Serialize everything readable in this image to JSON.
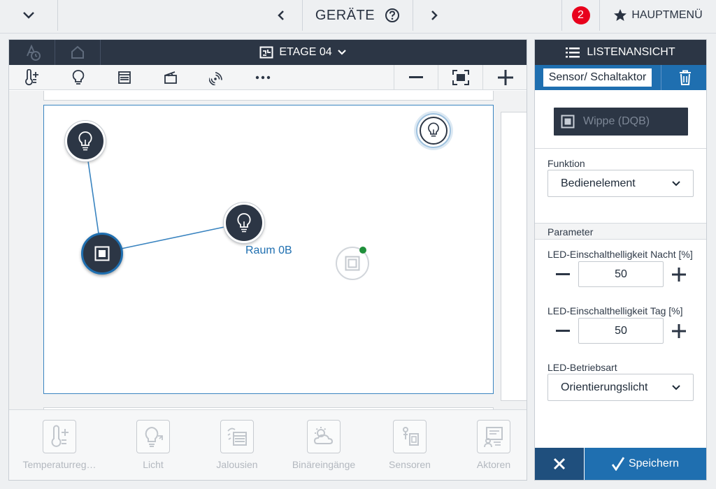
{
  "topbar": {
    "title": "GERÄTE",
    "badge_count": "2",
    "mainmenu_label": "HAUPTMENÜ"
  },
  "floor": {
    "label": "ETAGE 04"
  },
  "canvas": {
    "room_label": "Raum 0B"
  },
  "categories": [
    {
      "label": "Temperaturreg…",
      "icon": "thermometer-plus-icon"
    },
    {
      "label": "Licht",
      "icon": "bulb-icon"
    },
    {
      "label": "Jalousien",
      "icon": "blind-icon"
    },
    {
      "label": "Binäreingänge",
      "icon": "weather-sensor-icon"
    },
    {
      "label": "Sensoren",
      "icon": "sensor-icon"
    },
    {
      "label": "Aktoren",
      "icon": "actuator-icon"
    }
  ],
  "listpanel": {
    "title": "LISTENANSICHT",
    "sensor_name": "Sensor/ Schaltaktor",
    "wippe_label": "Wippe (DQB)",
    "funktion_label": "Funktion",
    "funktion_value": "Bedienelement",
    "parameter_label": "Parameter",
    "led_night_label": "LED-Einschalthelligkeit Nacht [%]",
    "led_night_value": "50",
    "led_day_label": "LED-Einschalthelligkeit Tag [%]",
    "led_day_value": "50",
    "led_mode_label": "LED-Betriebsart",
    "led_mode_value": "Orientierungslicht",
    "save_label": "Speichern"
  },
  "colors": {
    "dark": "#2c3645",
    "accent": "#1f6fb0",
    "badge": "#e8001c"
  }
}
